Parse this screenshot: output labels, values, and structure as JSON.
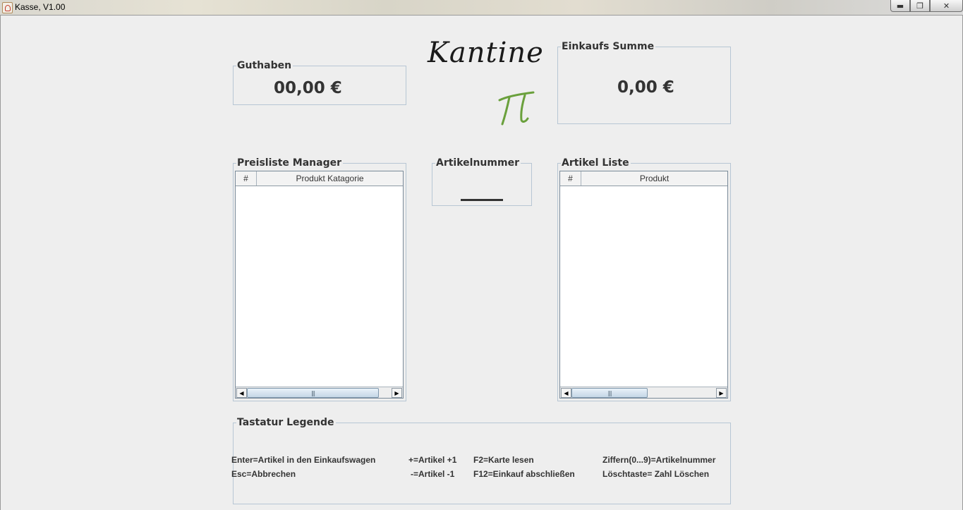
{
  "window": {
    "title": "Kasse, V1.00",
    "minimize_glyph": "▬",
    "restore_glyph": "❐",
    "close_glyph": "✕"
  },
  "logo": {
    "text": "Kantine",
    "symbol": "π",
    "symbol_color": "#6aa03c"
  },
  "guthaben": {
    "title": "Guthaben",
    "value": "00,00 €"
  },
  "einkaufs_summe": {
    "title": "Einkaufs Summe",
    "value": "0,00 €"
  },
  "preisliste": {
    "title": "Preisliste Manager",
    "columns": [
      "#",
      "Produkt Katagorie"
    ]
  },
  "artikelnummer": {
    "title": "Artikelnummer"
  },
  "artikel_liste": {
    "title": "Artikel Liste",
    "columns": [
      "#",
      "Produkt"
    ]
  },
  "legende": {
    "title": "Tastatur Legende",
    "items": [
      "Enter=Artikel in den Einkaufswagen",
      "Esc=Abbrechen",
      "+=Artikel +1",
      "-=Artikel -1",
      "F2=Karte lesen",
      "F12=Einkauf abschließen",
      "Ziffern(0...9)=Artikelnummer",
      "Löschtaste= Zahl Löschen"
    ]
  },
  "scrollbar": {
    "left_arrow": "◀",
    "right_arrow": "▶",
    "grip": "|||"
  },
  "colors": {
    "background": "#eeeeee",
    "border": "#b7c6d4",
    "text": "#333333"
  }
}
